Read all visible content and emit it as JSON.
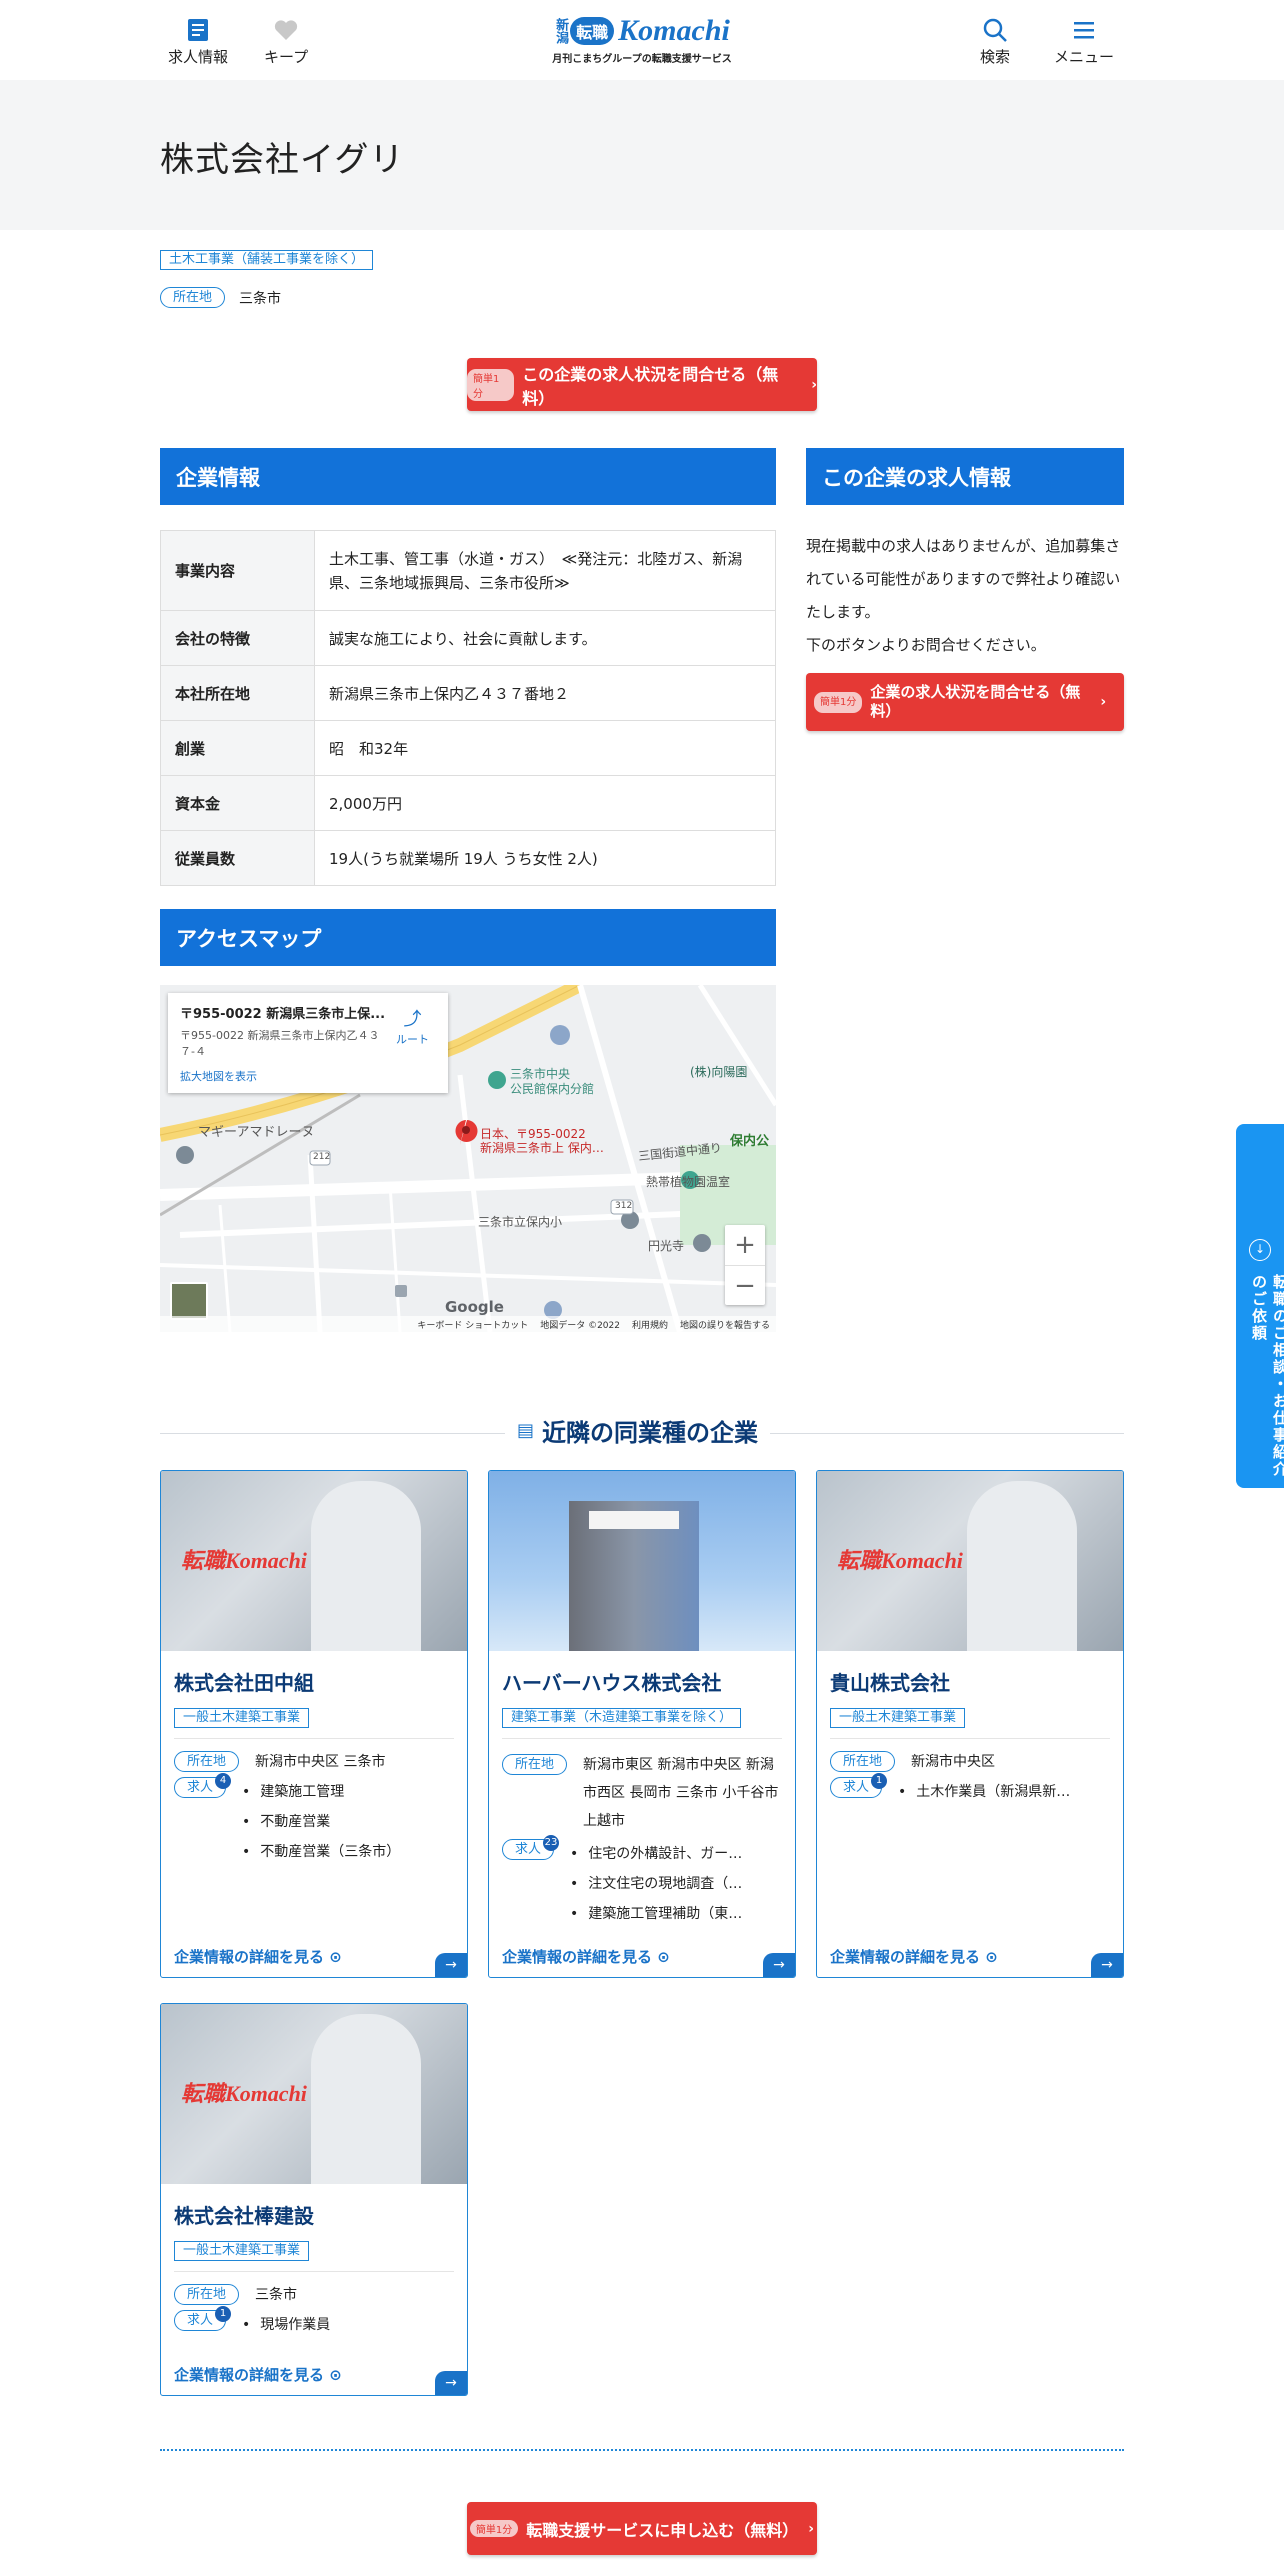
{
  "header": {
    "jobs_label": "求人情報",
    "keep_label": "キープ",
    "logo_niigata": "新潟",
    "logo_badge": "転職",
    "logo_text": "Komachi",
    "logo_tagline": "月刊こまちグループの転職支援サービス",
    "search_label": "検索",
    "menu_label": "メニュー"
  },
  "company": {
    "name": "株式会社イグリ",
    "industry_tag": "土木工事業（舗装工事業を除く）",
    "location_label": "所在地",
    "location_value": "三条市"
  },
  "cta_top": {
    "mini": "簡単1分",
    "label": "この企業の求人状況を問合せる（無料）"
  },
  "info_section": {
    "title": "企業情報",
    "rows": [
      {
        "key": "事業内容",
        "value": "土木工事、管工事（水道・ガス）　≪発注元：北陸ガス、新潟県、三条地域振興局、三条市役所≫"
      },
      {
        "key": "会社の特徴",
        "value": "誠実な施工により、社会に貢献します。"
      },
      {
        "key": "本社所在地",
        "value": "新潟県三条市上保内乙４３７番地２"
      },
      {
        "key": "創業",
        "value": "昭　和32年"
      },
      {
        "key": "資本金",
        "value": "2,000万円"
      },
      {
        "key": "従業員数",
        "value": "19人(うち就業場所 19人 うち女性 2人)"
      }
    ]
  },
  "jobs_section": {
    "title": "この企業の求人情報",
    "text": "現在掲載中の求人はありませんが、追加募集されている可能性がありますので弊社より確認いたします。\n下のボタンよりお問合せください。",
    "button_mini": "簡単1分",
    "button_label": "企業の求人状況を問合せる（無料）"
  },
  "map_section": {
    "title": "アクセスマップ",
    "popup_title": "〒955-0022 新潟県三条市上保...",
    "popup_addr": "〒955-0022 新潟県三条市上保内乙４３７-４",
    "popup_route": "ルート",
    "popup_enlarge": "拡大地図を表示",
    "pin_label1": "日本、〒955-0022",
    "pin_label2": "新潟県三条市上 保内…",
    "labels": {
      "koumin": "三条市中央\n公民館保内分館",
      "mukai": "(株)向陽園",
      "sankoku": "三国街道中通り",
      "hosonai": "保内公",
      "nettai": "熱帯植物園温室",
      "school": "三条市立保内小",
      "enkou": "円光寺",
      "magi": "マギーアマドレーヌ",
      "route212": "212",
      "route312": "312"
    },
    "google": "Google",
    "footer_shortcuts": "キーボード ショートカット",
    "footer_data": "地図データ ©2022",
    "footer_terms": "利用規約",
    "footer_report": "地図の誤りを報告する",
    "zoom_in": "+",
    "zoom_out": "−"
  },
  "side_tab": {
    "label": "転職のご相談・お仕事紹介のご依頼"
  },
  "nearby": {
    "title": "近隣の同業種の企業",
    "location_pill": "所在地",
    "jobs_pill": "求人",
    "more_label": "企業情報の詳細を見る",
    "cards": [
      {
        "name": "株式会社田中組",
        "tag": "一般土木建築工事業",
        "location": "新潟市中央区 三条市",
        "job_count": "4",
        "jobs": [
          "建築施工管理",
          "不動産営業",
          "不動産営業（三条市）"
        ]
      },
      {
        "name": "ハーバーハウス株式会社",
        "tag": "建築工事業（木造建築工事業を除く）",
        "location": "新潟市東区 新潟市中央区 新潟市西区 長岡市 三条市 小千谷市 上越市",
        "job_count": "23",
        "jobs": [
          "住宅の外構設計、ガー…",
          "注文住宅の現地調査（…",
          "建築施工管理補助（東…"
        ]
      },
      {
        "name": "貴山株式会社",
        "tag": "一般土木建築工事業",
        "location": "新潟市中央区",
        "job_count": "1",
        "jobs": [
          "土木作業員（新潟県新…"
        ]
      },
      {
        "name": "株式会社棒建設",
        "tag": "一般土木建築工事業",
        "location": "三条市",
        "job_count": "1",
        "jobs": [
          "現場作業員"
        ]
      }
    ]
  },
  "cta_bottom": {
    "mini": "簡単1分",
    "label": "転職支援サービスに申し込む（無料）"
  }
}
